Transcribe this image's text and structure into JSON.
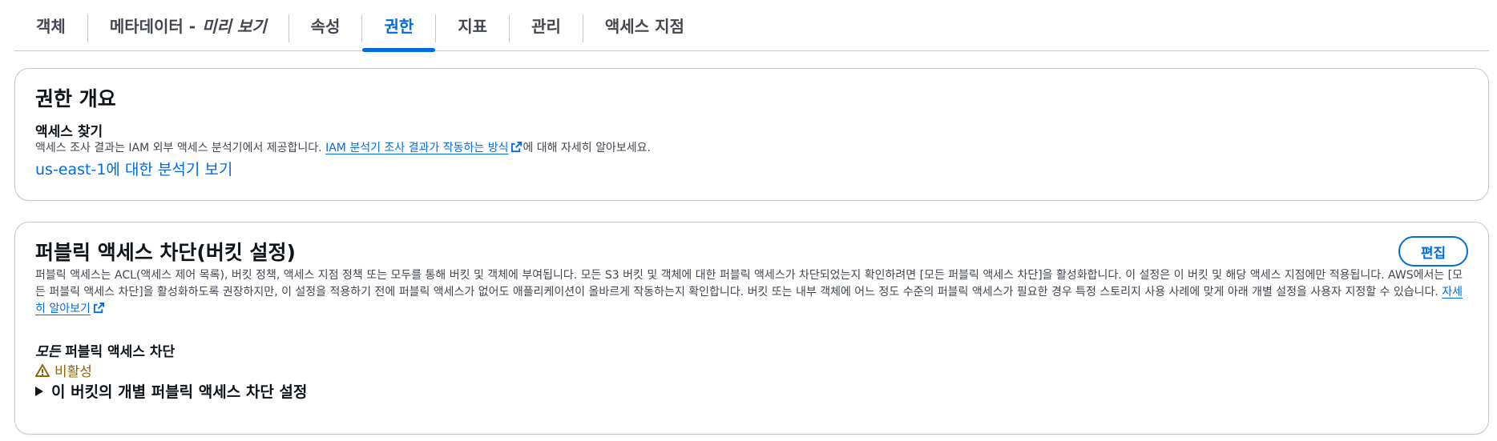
{
  "tabs": [
    {
      "label": "객체",
      "active": false
    },
    {
      "label": "메타데이터 -",
      "italic_suffix": "미리 보기",
      "active": false
    },
    {
      "label": "속성",
      "active": false
    },
    {
      "label": "권한",
      "active": true
    },
    {
      "label": "지표",
      "active": false
    },
    {
      "label": "관리",
      "active": false
    },
    {
      "label": "액세스 지점",
      "active": false
    }
  ],
  "permissions_overview": {
    "title": "권한 개요",
    "access_finding_title": "액세스 찾기",
    "desc_prefix": "액세스 조사 결과는 IAM 외부 액세스 분석기에서 제공합니다.",
    "desc_link": "IAM 분석기 조사 결과가 작동하는 방식",
    "desc_suffix": "에 대해 자세히 알아보세요.",
    "region_link": "us-east-1에 대한 분석기 보기"
  },
  "block_public_access": {
    "title": "퍼블릭 액세스 차단(버킷 설정)",
    "edit_label": "편집",
    "description": "퍼블릭 액세스는 ACL(액세스 제어 목록), 버킷 정책, 액세스 지점 정책 또는 모두를 통해 버킷 및 객체에 부여됩니다. 모든 S3 버킷 및 객체에 대한 퍼블릭 액세스가 차단되었는지 확인하려면 [모든 퍼블릭 액세스 차단]을 활성화합니다. 이 설정은 이 버킷 및 해당 액세스 지점에만 적용됩니다. AWS에서는 [모든 퍼블릭 액세스 차단]을 활성화하도록 권장하지만, 이 설정을 적용하기 전에 퍼블릭 액세스가 없어도 애플리케이션이 올바르게 작동하는지 확인합니다. 버킷 또는 내부 객체에 어느 정도 수준의 퍼블릭 액세스가 필요한 경우 특정 스토리지 사용 사례에 맞게 아래 개별 설정을 사용자 지정할 수 있습니다.",
    "learn_more": "자세히 알아보기",
    "all_block_italic": "모든",
    "all_block_label": "퍼블릭 액세스 차단",
    "status": "비활성",
    "expander_label": "이 버킷의 개별 퍼블릭 액세스 차단 설정"
  },
  "colors": {
    "accent": "#006ce0",
    "warning": "#8d6605",
    "text": "#0f141a",
    "secondary_text": "#424650",
    "border": "#c6c6cd"
  }
}
